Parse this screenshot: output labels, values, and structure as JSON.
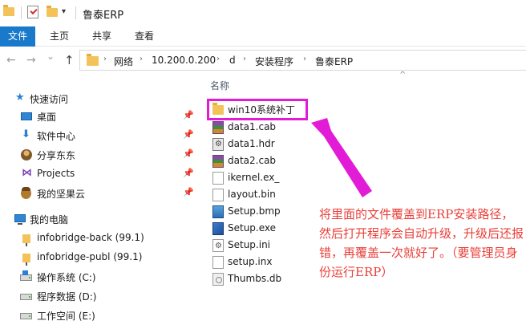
{
  "window": {
    "title": "鲁泰ERP",
    "quick_access_dropdown": "▾"
  },
  "ribbon": {
    "tabs": [
      "文件",
      "主页",
      "共享",
      "查看"
    ]
  },
  "navigation": {
    "back": "←",
    "forward": "→",
    "recent": "⌄",
    "up": "↑",
    "breadcrumb": [
      "网络",
      "10.200.0.200",
      "d",
      "安装程序",
      "鲁泰ERP"
    ],
    "breadcrumb_separator": "›"
  },
  "sidebar": {
    "quick_access_label": "快速访问",
    "quick_items": [
      {
        "label": "桌面",
        "icon": "desktop-icon"
      },
      {
        "label": "软件中心",
        "icon": "download-icon"
      },
      {
        "label": "分享东东",
        "icon": "share-icon"
      },
      {
        "label": "Projects",
        "icon": "visual-studio-icon"
      },
      {
        "label": "我的坚果云",
        "icon": "nutstore-icon"
      }
    ],
    "pin_glyph": "📌",
    "this_pc_label": "我的电脑",
    "pc_items": [
      {
        "label": "infobridge-back (99.1)",
        "icon": "network-drive-icon"
      },
      {
        "label": "infobridge-publ (99.1)",
        "icon": "network-drive-icon"
      },
      {
        "label": "操作系统 (C:)",
        "icon": "system-drive-icon"
      },
      {
        "label": "程序数据 (D:)",
        "icon": "drive-icon"
      },
      {
        "label": "工作空间 (E:)",
        "icon": "drive-icon"
      }
    ]
  },
  "file_list": {
    "column_name": "名称",
    "sort_caret": "^",
    "files": [
      {
        "name": "win10系统补丁",
        "type": "folder"
      },
      {
        "name": "data1.cab",
        "type": "cab"
      },
      {
        "name": "data1.hdr",
        "type": "hdr"
      },
      {
        "name": "data2.cab",
        "type": "cab"
      },
      {
        "name": "ikernel.ex_",
        "type": "doc"
      },
      {
        "name": "layout.bin",
        "type": "doc"
      },
      {
        "name": "Setup.bmp",
        "type": "bmp"
      },
      {
        "name": "Setup.exe",
        "type": "exe"
      },
      {
        "name": "Setup.ini",
        "type": "ini"
      },
      {
        "name": "setup.inx",
        "type": "doc"
      },
      {
        "name": "Thumbs.db",
        "type": "db"
      }
    ]
  },
  "annotation": {
    "text": "将里面的文件覆盖到ERP安装路径，然后打开程序会自动升级，升级后还报错，再覆盖一次就好了。（要管理员身份运行ERP）",
    "color": "#e8403a",
    "highlight_color": "#e21bd6"
  }
}
